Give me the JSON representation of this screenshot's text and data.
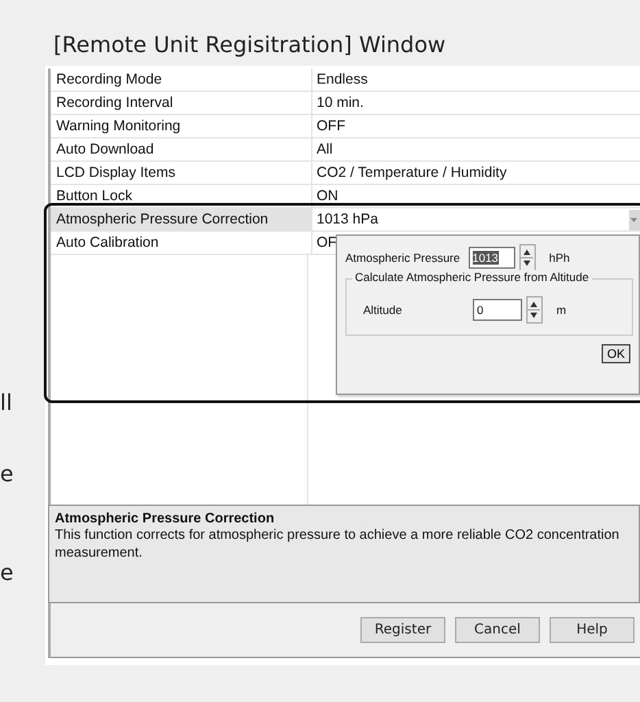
{
  "title": "[Remote Unit Regisitration] Window",
  "margin_fragments": [
    "ll",
    "e",
    "e"
  ],
  "properties": [
    {
      "label": "Recording Mode",
      "value": "Endless",
      "selected": false
    },
    {
      "label": "Recording Interval",
      "value": "10 min.",
      "selected": false
    },
    {
      "label": "Warning Monitoring",
      "value": "OFF",
      "selected": false
    },
    {
      "label": "Auto Download",
      "value": "All",
      "selected": false
    },
    {
      "label": "LCD Display Items",
      "value": "CO2 / Temperature / Humidity",
      "selected": false
    },
    {
      "label": "Button Lock",
      "value": "ON",
      "selected": false
    },
    {
      "label": "Atmospheric Pressure Correction",
      "value": "1013 hPa",
      "selected": true
    },
    {
      "label": "Auto Calibration",
      "value": "OF",
      "selected": false
    }
  ],
  "dropdown": {
    "pressure_label": "Atmospheric Pressure",
    "pressure_value": "1013",
    "value_selected": true,
    "pressure_unit": "hPh",
    "group_title": "Calculate Atmospheric Pressure from Altitude",
    "altitude_label": "Altitude",
    "altitude_value": "0",
    "altitude_unit": "m",
    "ok": "OK"
  },
  "description": {
    "title": "Atmospheric Pressure Correction",
    "text": "This function corrects for atmospheric pressure to achieve a more reliable CO2 concentration measurement."
  },
  "buttons": [
    "Register",
    "Cancel",
    "Help"
  ]
}
